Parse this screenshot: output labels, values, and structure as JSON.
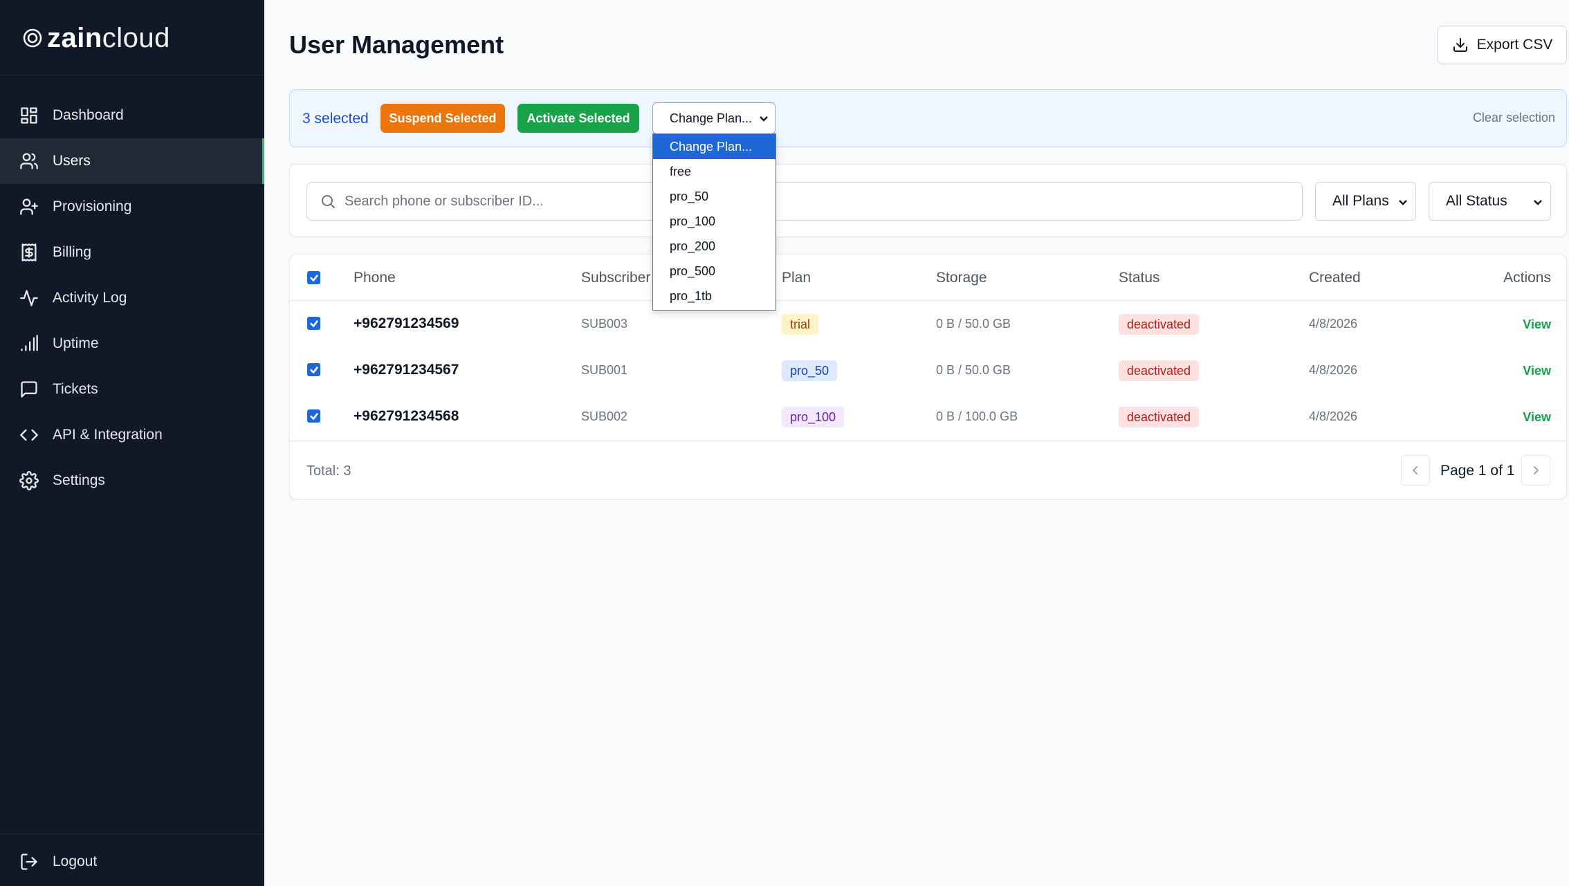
{
  "brand": {
    "logo_bold": "zain",
    "logo_light": "cloud"
  },
  "sidebar": {
    "items": [
      {
        "label": "Dashboard",
        "icon": "dashboard-icon"
      },
      {
        "label": "Users",
        "icon": "users-icon",
        "active": true
      },
      {
        "label": "Provisioning",
        "icon": "user-plus-icon"
      },
      {
        "label": "Billing",
        "icon": "receipt-dollar-icon"
      },
      {
        "label": "Activity Log",
        "icon": "activity-icon"
      },
      {
        "label": "Uptime",
        "icon": "signal-bars-icon"
      },
      {
        "label": "Tickets",
        "icon": "message-square-icon"
      },
      {
        "label": "API & Integration",
        "icon": "code-icon"
      },
      {
        "label": "Settings",
        "icon": "gear-icon"
      }
    ],
    "logout_label": "Logout"
  },
  "header": {
    "title": "User Management",
    "export_label": "Export CSV"
  },
  "bulk": {
    "selected_text": "3 selected",
    "suspend_label": "Suspend Selected",
    "activate_label": "Activate Selected",
    "plan_select_value": "Change Plan...",
    "clear_label": "Clear selection",
    "plan_options": [
      "Change Plan...",
      "free",
      "pro_50",
      "pro_100",
      "pro_200",
      "pro_500",
      "pro_1tb"
    ]
  },
  "filters": {
    "search_placeholder": "Search phone or subscriber ID...",
    "plan_filter": "All Plans",
    "status_filter": "All Status"
  },
  "table": {
    "columns": [
      "Phone",
      "Subscriber",
      "Plan",
      "Storage",
      "Status",
      "Created",
      "Actions"
    ],
    "rows": [
      {
        "phone": "+962791234569",
        "subscriber": "SUB003",
        "plan": "trial",
        "storage": "0 B / 50.0 GB",
        "status": "deactivated",
        "created": "4/8/2026",
        "action": "View"
      },
      {
        "phone": "+962791234567",
        "subscriber": "SUB001",
        "plan": "pro_50",
        "storage": "0 B / 50.0 GB",
        "status": "deactivated",
        "created": "4/8/2026",
        "action": "View"
      },
      {
        "phone": "+962791234568",
        "subscriber": "SUB002",
        "plan": "pro_100",
        "storage": "0 B / 100.0 GB",
        "status": "deactivated",
        "created": "4/8/2026",
        "action": "View"
      }
    ],
    "total_text": "Total: 3",
    "page_text": "Page 1 of 1"
  },
  "colors": {
    "sidebar_bg": "#111827",
    "accent_green": "#16a34a",
    "accent_orange": "#ea760c",
    "accent_blue": "#1d68d6",
    "badge_trial_bg": "#fef3c7",
    "badge_pro50_bg": "#dbeafe",
    "badge_pro100_bg": "#f3e8ff",
    "badge_deactivated_bg": "#fee2e2"
  }
}
